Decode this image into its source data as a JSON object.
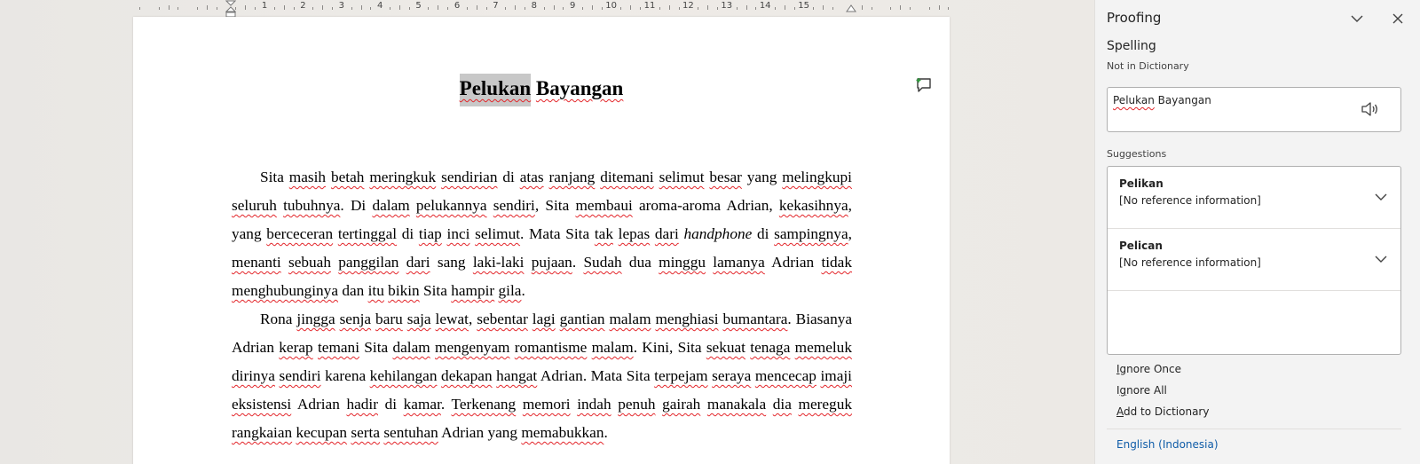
{
  "ruler": {
    "numbers": [
      "1",
      "2",
      "3",
      "4",
      "5",
      "6",
      "7",
      "8",
      "9",
      "10",
      "11",
      "12",
      "13",
      "14",
      "15"
    ]
  },
  "document": {
    "title_word1": "Pelukan",
    "title_word2": "Bayangan",
    "paragraphs": [
      [
        {
          "t": "Sita "
        },
        {
          "t": "masih",
          "sq": true
        },
        {
          "t": " "
        },
        {
          "t": "betah",
          "sq": true
        },
        {
          "t": " "
        },
        {
          "t": "meringkuk",
          "sq": true
        },
        {
          "t": " "
        },
        {
          "t": "sendirian",
          "sq": true
        },
        {
          "t": " di "
        },
        {
          "t": "atas",
          "sq": true
        },
        {
          "t": " "
        },
        {
          "t": "ranjang",
          "sq": true
        },
        {
          "t": " "
        },
        {
          "t": "ditemani",
          "sq": true
        },
        {
          "t": " "
        },
        {
          "t": "selimut",
          "sq": true
        },
        {
          "t": " "
        },
        {
          "t": "besar",
          "sq": true
        },
        {
          "t": " yang "
        },
        {
          "t": "melingkupi",
          "sq": true
        },
        {
          "t": " "
        },
        {
          "t": "seluruh",
          "sq": true
        },
        {
          "t": " "
        },
        {
          "t": "tubuhnya",
          "sq": true
        },
        {
          "t": ". Di "
        },
        {
          "t": "dalam",
          "sq": true
        },
        {
          "t": " "
        },
        {
          "t": "pelukannya",
          "sq": true
        },
        {
          "t": " "
        },
        {
          "t": "sendiri",
          "sq": true
        },
        {
          "t": ", Sita "
        },
        {
          "t": "membaui",
          "sq": true
        },
        {
          "t": " aroma-aroma Adrian, "
        },
        {
          "t": "kekasihnya",
          "sq": true
        },
        {
          "t": ", yang "
        },
        {
          "t": "berceceran",
          "sq": true
        },
        {
          "t": " "
        },
        {
          "t": "tertinggal",
          "sq": true
        },
        {
          "t": " di "
        },
        {
          "t": "tiap",
          "sq": true
        },
        {
          "t": " "
        },
        {
          "t": "inci",
          "sq": true
        },
        {
          "t": " "
        },
        {
          "t": "selimut",
          "sq": true
        },
        {
          "t": ". Mata Sita "
        },
        {
          "t": "tak",
          "sq": true
        },
        {
          "t": " "
        },
        {
          "t": "lepas",
          "sq": true
        },
        {
          "t": " "
        },
        {
          "t": "dari",
          "sq": true
        },
        {
          "t": " "
        },
        {
          "t": "handphone",
          "it": true
        },
        {
          "t": " di "
        },
        {
          "t": "sampingnya",
          "sq": true
        },
        {
          "t": ", "
        },
        {
          "t": "menanti",
          "sq": true
        },
        {
          "t": " "
        },
        {
          "t": "sebuah",
          "sq": true
        },
        {
          "t": " "
        },
        {
          "t": "panggilan",
          "sq": true
        },
        {
          "t": " "
        },
        {
          "t": "dari",
          "sq": true
        },
        {
          "t": " sang "
        },
        {
          "t": "laki-laki",
          "sq": true
        },
        {
          "t": " "
        },
        {
          "t": "pujaan",
          "sq": true
        },
        {
          "t": ". "
        },
        {
          "t": "Sudah",
          "sq": true
        },
        {
          "t": " dua "
        },
        {
          "t": "minggu",
          "sq": true
        },
        {
          "t": " "
        },
        {
          "t": "lamanya",
          "sq": true
        },
        {
          "t": " Adrian "
        },
        {
          "t": "tidak",
          "sq": true
        },
        {
          "t": " "
        },
        {
          "t": "menghubunginya",
          "sq": true
        },
        {
          "t": " dan "
        },
        {
          "t": "itu",
          "sq": true
        },
        {
          "t": " "
        },
        {
          "t": "bikin",
          "sq": true
        },
        {
          "t": " Sita "
        },
        {
          "t": "hampir",
          "sq": true
        },
        {
          "t": " "
        },
        {
          "t": "gila",
          "sq": true
        },
        {
          "t": "."
        }
      ],
      [
        {
          "t": "Rona "
        },
        {
          "t": "jingga",
          "sq": true
        },
        {
          "t": " "
        },
        {
          "t": "senja",
          "sq": true
        },
        {
          "t": " "
        },
        {
          "t": "baru",
          "sq": true
        },
        {
          "t": " "
        },
        {
          "t": "saja",
          "sq": true
        },
        {
          "t": " "
        },
        {
          "t": "lewat",
          "sq": true
        },
        {
          "t": ", "
        },
        {
          "t": "sebentar",
          "sq": true
        },
        {
          "t": " "
        },
        {
          "t": "lagi",
          "sq": true
        },
        {
          "t": " "
        },
        {
          "t": "gantian",
          "sq": true
        },
        {
          "t": " "
        },
        {
          "t": "malam",
          "sq": true
        },
        {
          "t": " "
        },
        {
          "t": "menghiasi",
          "sq": true
        },
        {
          "t": " "
        },
        {
          "t": "bumantara",
          "sq": true
        },
        {
          "t": ". "
        },
        {
          "t": "Biasanya Adrian "
        },
        {
          "t": "kerap",
          "sq": true
        },
        {
          "t": " "
        },
        {
          "t": "temani",
          "sq": true
        },
        {
          "t": " Sita "
        },
        {
          "t": "dalam",
          "sq": true
        },
        {
          "t": " "
        },
        {
          "t": "mengenyam",
          "sq": true
        },
        {
          "t": " "
        },
        {
          "t": "romantisme",
          "sq": true
        },
        {
          "t": " "
        },
        {
          "t": "malam",
          "sq": true
        },
        {
          "t": ". Kini, Sita "
        },
        {
          "t": "sekuat",
          "sq": true
        },
        {
          "t": " "
        },
        {
          "t": "tenaga",
          "sq": true
        },
        {
          "t": " "
        },
        {
          "t": "memeluk",
          "sq": true
        },
        {
          "t": " "
        },
        {
          "t": "dirinya",
          "sq": true
        },
        {
          "t": " "
        },
        {
          "t": "sendiri",
          "sq": true
        },
        {
          "t": " karena "
        },
        {
          "t": "kehilangan",
          "sq": true
        },
        {
          "t": " "
        },
        {
          "t": "dekapan",
          "sq": true
        },
        {
          "t": " "
        },
        {
          "t": "hangat",
          "sq": true
        },
        {
          "t": " Adrian. Mata Sita "
        },
        {
          "t": "terpejam",
          "sq": true
        },
        {
          "t": " "
        },
        {
          "t": "seraya",
          "sq": true
        },
        {
          "t": " "
        },
        {
          "t": "mencecap",
          "sq": true
        },
        {
          "t": " "
        },
        {
          "t": "imaji",
          "sq": true
        },
        {
          "t": " "
        },
        {
          "t": "eksistensi",
          "sq": true
        },
        {
          "t": " Adrian "
        },
        {
          "t": "hadir",
          "sq": true
        },
        {
          "t": " di "
        },
        {
          "t": "kamar",
          "sq": true
        },
        {
          "t": ". "
        },
        {
          "t": "Terkenang",
          "sq": true
        },
        {
          "t": " "
        },
        {
          "t": "memori",
          "sq": true
        },
        {
          "t": " "
        },
        {
          "t": "indah",
          "sq": true
        },
        {
          "t": " "
        },
        {
          "t": "penuh",
          "sq": true
        },
        {
          "t": " "
        },
        {
          "t": "gairah",
          "sq": true
        },
        {
          "t": " "
        },
        {
          "t": "manakala",
          "sq": true
        },
        {
          "t": " "
        },
        {
          "t": "dia",
          "sq": true
        },
        {
          "t": " "
        },
        {
          "t": "mereguk",
          "sq": true
        },
        {
          "t": " "
        },
        {
          "t": "rangkaian",
          "sq": true
        },
        {
          "t": " "
        },
        {
          "t": "kecupan",
          "sq": true
        },
        {
          "t": " "
        },
        {
          "t": "serta",
          "sq": true
        },
        {
          "t": " "
        },
        {
          "t": "sentuhan",
          "sq": true
        },
        {
          "t": " Adrian yang "
        },
        {
          "t": "memabukkan",
          "sq": true
        },
        {
          "t": "."
        }
      ]
    ]
  },
  "pane": {
    "title": "Proofing",
    "section": "Spelling",
    "subheading": "Not in Dictionary",
    "context_text": "Pelukan Bayangan",
    "suggestions_label": "Suggestions",
    "suggestions": [
      {
        "word": "Pelikan",
        "info": "[No reference information]"
      },
      {
        "word": "Pelican",
        "info": "[No reference information]"
      }
    ],
    "actions": [
      "Ignore Once",
      "Ignore All",
      "Add to Dictionary"
    ],
    "language": "English (Indonesia)"
  },
  "icons": {
    "collapse": "chevron-down-icon",
    "close": "close-icon",
    "speaker": "speaker-icon",
    "comment": "add-comment-icon"
  },
  "colors": {
    "squiggle": "#e3262b",
    "link": "#0f5ca8",
    "selection": "#c8c8c8"
  }
}
